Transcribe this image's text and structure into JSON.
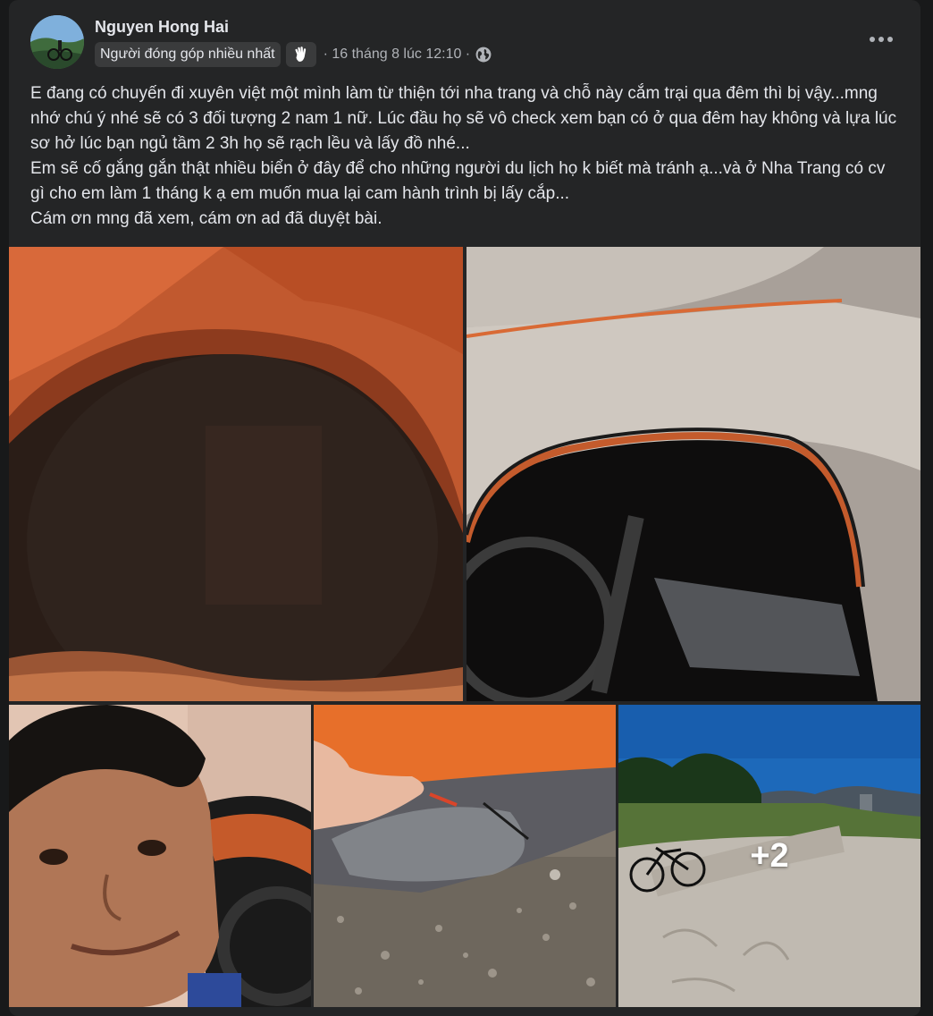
{
  "post": {
    "author": "Nguyen Hong Hai",
    "badge": "Người đóng góp nhiều nhất",
    "badge_icon": "waving-hand-icon",
    "timestamp": "· 16 tháng 8 lúc 12:10 ·",
    "privacy_icon": "globe-icon",
    "more_icon": "more-options-icon",
    "text_lines": [
      "E đang có chuyến đi xuyên việt một mình làm từ thiện tới nha trang và chỗ này cắm trại qua đêm thì bị vậy...mng nhớ chú ý nhé sẽ có 3 đối tượng 2 nam 1 nữ. Lúc đầu họ sẽ vô check xem bạn có ở qua đêm hay không và lựa lúc sơ hở lúc bạn ngủ tầm 2 3h họ sẽ rạch lều và lấy đồ nhé...",
      "Em sẽ cố gắng gắn thật nhiều biển ở đây để cho những người du lịch họ k biết mà tránh ạ...và ở Nha Trang có cv gì cho em làm 1 tháng k ạ em muốn mua lại cam hành trình bị lấy cắp...",
      "Cám ơn mng đã xem, cám ơn ad đã duyệt bài."
    ]
  },
  "photos": {
    "more_count": "+2",
    "items": [
      {
        "name": "tent-interior-dark-photo"
      },
      {
        "name": "tent-with-bicycle-photo"
      },
      {
        "name": "selfie-photo"
      },
      {
        "name": "slashed-tent-photo"
      },
      {
        "name": "beach-bicycle-photo"
      }
    ]
  },
  "colors": {
    "background": "#18191a",
    "card": "#242526",
    "text_primary": "#e4e6eb",
    "text_secondary": "#b0b3b8",
    "badge_bg": "#3a3b3c"
  }
}
